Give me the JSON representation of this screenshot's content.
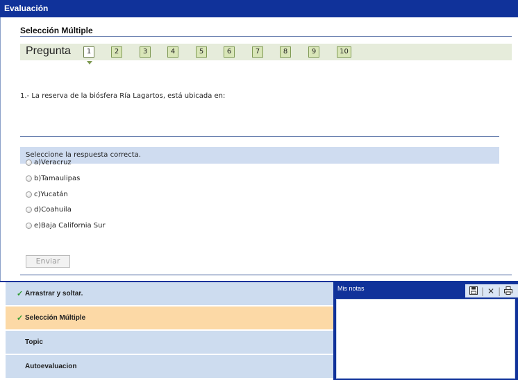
{
  "window": {
    "title": "Evaluación"
  },
  "section": {
    "title": "Selección Múltiple"
  },
  "pager": {
    "label": "Pregunta",
    "pages": [
      "1",
      "2",
      "3",
      "4",
      "5",
      "6",
      "7",
      "8",
      "9",
      "10"
    ],
    "current": "1"
  },
  "question": {
    "text": "1.- La reserva de la biósfera Ría Lagartos, está ubicada en:"
  },
  "instruction": "Seleccione la respuesta correcta.",
  "options": [
    "a)Veracruz",
    "b)Tamaulipas",
    "c)Yucatán",
    "d)Coahuila",
    "e)Baja California Sur"
  ],
  "submit_label": "Enviar",
  "nav": {
    "items": [
      {
        "label": "Arrastrar y soltar.",
        "checked": true
      },
      {
        "label": "Selección Múltiple",
        "checked": true,
        "active": true
      },
      {
        "label": "Topic",
        "checked": false
      },
      {
        "label": "Autoevaluacion",
        "checked": false
      }
    ],
    "check_glyph": "✓"
  },
  "notes": {
    "title": "Mis notas",
    "icons": [
      "save-icon",
      "close-icon",
      "print-icon"
    ]
  },
  "colors": {
    "titlebar": "#10329a",
    "nav_item": "#cddcef",
    "nav_active": "#fcd9a6",
    "pager_bg": "#e6ecdb",
    "page_button": "#d9e6b8",
    "instruction_bg": "#cfdcf0"
  }
}
